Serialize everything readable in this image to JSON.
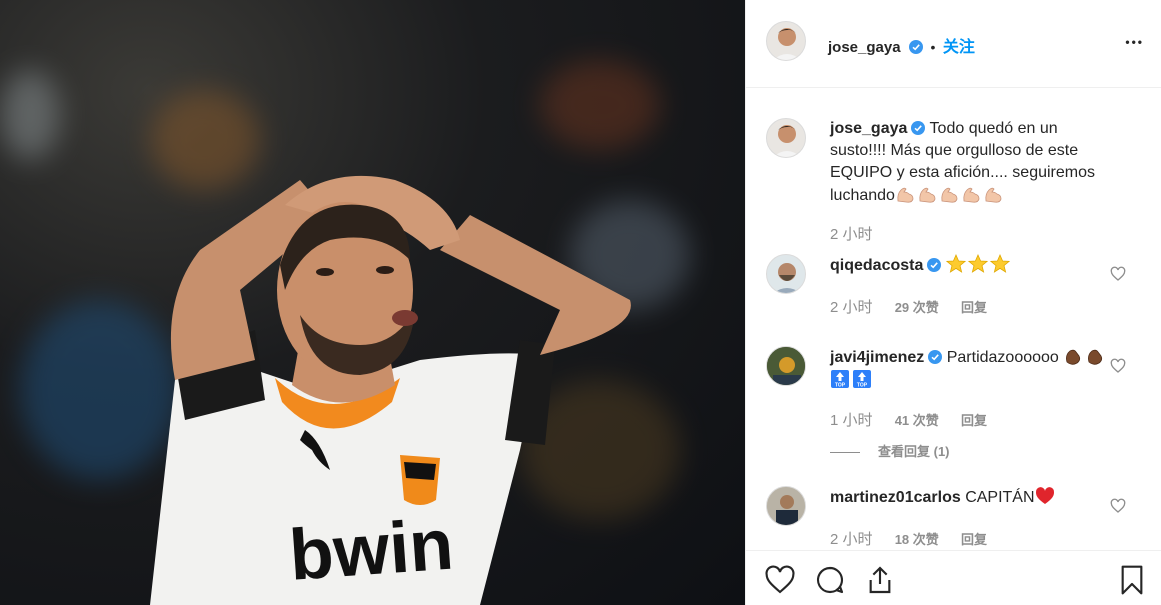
{
  "post": {
    "author": "jose_gaya",
    "follow_separator": "•",
    "follow_label": "关注",
    "more_label": "•••"
  },
  "caption": {
    "username": "jose_gaya",
    "text": "Todo quedó en un susto!!!! Más que orgulloso de este EQUIPO y esta afición.... seguiremos luchando",
    "emoji": [
      "flexed-biceps",
      "flexed-biceps",
      "flexed-biceps",
      "flexed-biceps",
      "flexed-biceps"
    ],
    "time": "2 小时"
  },
  "comments": [
    {
      "username": "qiqedacosta",
      "text": "",
      "emoji": [
        "star",
        "star",
        "star"
      ],
      "time": "2 小时",
      "likes": "29 次赞",
      "reply": "回复"
    },
    {
      "username": "javi4jimenez",
      "text": "Partidazoooooo",
      "emoji": [
        "clapping-hands",
        "clapping-hands",
        "top-arrow",
        "top-arrow"
      ],
      "time": "1 小时",
      "likes": "41 次赞",
      "reply": "回复",
      "view_replies": "查看回复 (1)"
    },
    {
      "username": "martinez01carlos",
      "text": "CAPITÁN",
      "emoji": [
        "red-heart"
      ],
      "time": "2 小时",
      "likes": "18 次赞",
      "reply": "回复"
    }
  ],
  "photo": {
    "jersey_text": "bwin"
  },
  "actions": {
    "like": "heart-icon",
    "comment": "comment-icon",
    "share": "share-icon",
    "save": "bookmark-icon"
  },
  "colors": {
    "accent": "#0095f6",
    "text": "#262626",
    "muted": "#8e8e8e",
    "verified": "#3897f0",
    "heart": "#ed4956"
  }
}
